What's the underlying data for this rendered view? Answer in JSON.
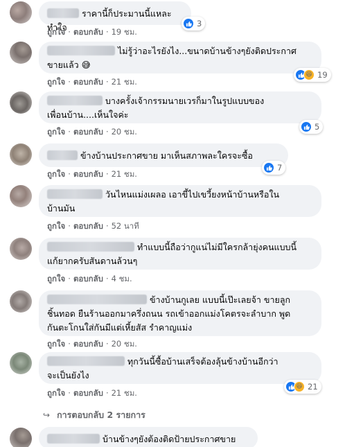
{
  "comments": [
    {
      "text": "ราคานี้ก็ประมานนี้แหละ ทำใจ",
      "like": "ถูกใจ",
      "reply": "ตอบกลับ",
      "time": "19 ชม.",
      "reactions": "3"
    },
    {
      "text_line1": "ไม่รู้ว่าอะไรยังไง...ขนาดบ้านข้างๆยังติดประกาศ",
      "text_line2": "ขายแล้ว 😅",
      "like": "ถูกใจ",
      "reply": "ตอบกลับ",
      "time": "21 ชม.",
      "reactions": "19"
    },
    {
      "text_line1": "บางครั้งเจ้ากรรมนายเวรก็มาในรูปแบบของ",
      "text_line2": "เพื่อนบ้าน....เห็นใจค่ะ",
      "like": "ถูกใจ",
      "reply": "ตอบกลับ",
      "time": "20 ชม.",
      "reactions": "5"
    },
    {
      "text": "ข้างบ้านประกาศขาย มาเห็นสภาพละใครจะซื้อ",
      "like": "ถูกใจ",
      "reply": "ตอบกลับ",
      "time": "21 ชม.",
      "reactions": "7"
    },
    {
      "text_line1": "วันไหนแม่งเผลอ เอาขี้ไปเขวี้ยงหน้าบ้านหรือใน",
      "text_line2": "บ้านมัน",
      "like": "ถูกใจ",
      "reply": "ตอบกลับ",
      "time": "52 นาที"
    },
    {
      "text_line1": "ทำแบบนี้ถือว่ากูแน่ไม่มีใครกล้ายุ่งคนแบบนี้",
      "text_line2": "แก้ยากครับสันดานล้วนๆ",
      "like": "ถูกใจ",
      "reply": "ตอบกลับ",
      "time": "4 ชม."
    },
    {
      "text_line1": "ข้างบ้านกูเลย แบบนี้เป๊ะเลยจ้า ขายลูก",
      "text_line2": "ชิ้นทอด ยืนร้านออกมาครึ่งถนน รถเข้าออกแม่งโคตรจะลำบาก พูด",
      "text_line3": "กันตะโกนใส่กันมีแต่เหี้ยสัส รำคาญแม่ง",
      "like": "ถูกใจ",
      "reply": "ตอบกลับ",
      "time": "20 ชม."
    },
    {
      "text_line1": "ทุกวันนี้ซื้อบ้านเสร็จต้องลุ้นข้างบ้านอีกว่า",
      "text_line2": "จะเป็นยังไง",
      "like": "ถูกใจ",
      "reply": "ตอบกลับ",
      "time": "21 ชม.",
      "reactions": "21"
    },
    {
      "text": "บ้านข้างๆยังต้องติดป้ายประกาศขาย"
    }
  ],
  "replies_link": "การตอบกลับ 2 รายการ",
  "colors": {
    "bubble": "#f0f2f5",
    "like_blue": "#1877f2",
    "haha_yellow": "#f7b125",
    "meta_gray": "#65676b"
  }
}
